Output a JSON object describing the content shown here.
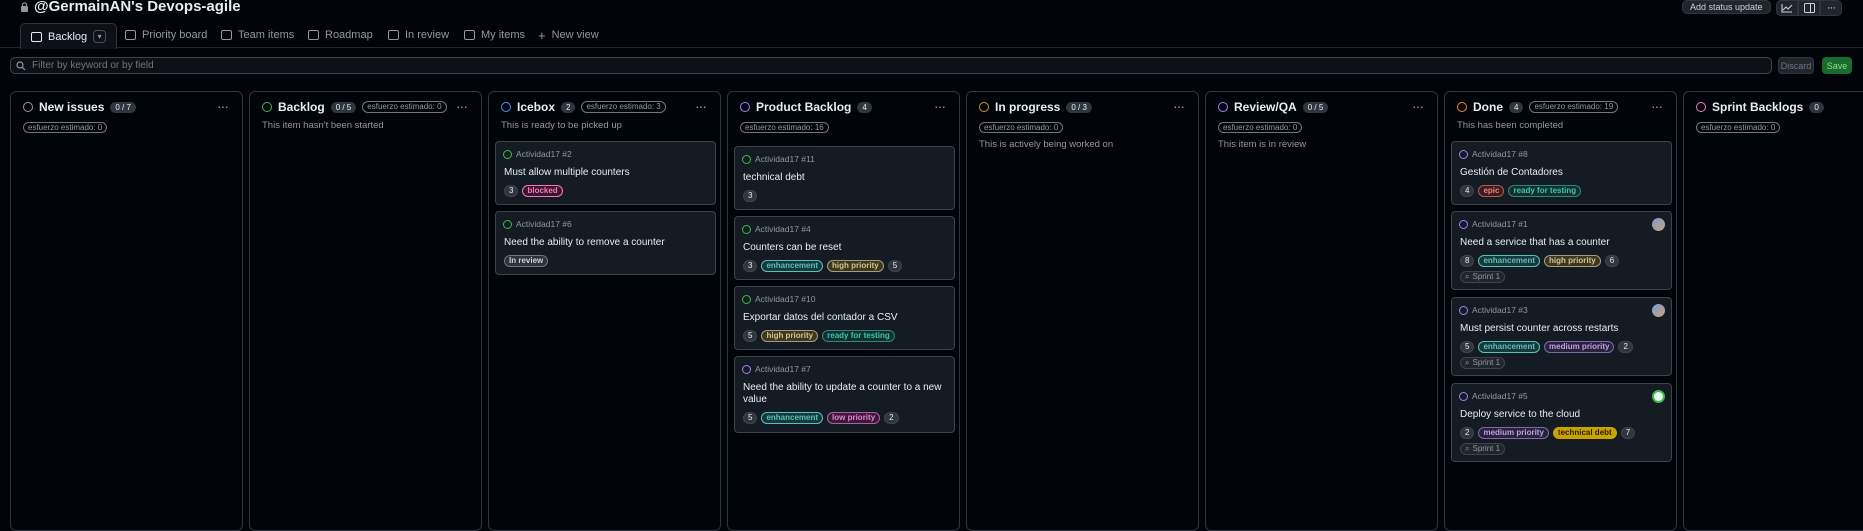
{
  "header": {
    "title": "@GermainAN's Devops-agile",
    "add_status_label": "Add status update"
  },
  "tabs": [
    {
      "label": "Backlog",
      "icon": "board-icon"
    },
    {
      "label": "Priority board",
      "icon": "board-icon"
    },
    {
      "label": "Team items",
      "icon": "table-icon"
    },
    {
      "label": "Roadmap",
      "icon": "roadmap-icon"
    },
    {
      "label": "In review",
      "icon": "table-icon"
    },
    {
      "label": "My items",
      "icon": "table-icon"
    },
    {
      "label": "New view",
      "icon": "plus-icon"
    }
  ],
  "filter": {
    "placeholder": "Filter by keyword or by field",
    "discard_label": "Discard",
    "save_label": "Save"
  },
  "colors": {
    "gray": "#9198a1",
    "green": "#3fb950",
    "blue": "#4493f8",
    "purple": "#ab7df8",
    "orange": "#d29922",
    "done": "#f0883e",
    "pink": "#f778ba",
    "enhancement": "#5ebfbf",
    "high_priority": "#d4c48a",
    "blocked": "#f778ba"
  },
  "columns": [
    {
      "name": "New issues",
      "count": "0 / 7",
      "estimate": "esfuerzo estimado: 0",
      "desc": "",
      "color": "gray"
    },
    {
      "name": "Backlog",
      "count": "0 / 5",
      "estimate": "esfuerzo estimado: 0",
      "desc": "This item hasn't been started",
      "color": "green"
    },
    {
      "name": "Icebox",
      "count": "2",
      "estimate": "esfuerzo estimado: 3",
      "desc": "This is ready to be picked up",
      "color": "blue"
    },
    {
      "name": "Product Backlog",
      "count": "4",
      "estimate": "esfuerzo estimado: 16",
      "desc": "",
      "color": "purple"
    },
    {
      "name": "In progress",
      "count": "0 / 3",
      "estimate": "esfuerzo estimado: 0",
      "desc": "This is actively being worked on",
      "color": "orange"
    },
    {
      "name": "Review/QA",
      "count": "0 / 5",
      "estimate": "esfuerzo estimado: 0",
      "desc": "This item is in review",
      "color": "purple"
    },
    {
      "name": "Done",
      "count": "4",
      "estimate": "esfuerzo estimado: 19",
      "desc": "This has been completed",
      "color": "done"
    },
    {
      "name": "Sprint Backlogs",
      "count": "0",
      "estimate": "esfuerzo estimado: 0",
      "desc": "",
      "color": "pink"
    }
  ],
  "cards": {
    "icebox": [
      {
        "ref": "Actividad17 #2",
        "title": "Must allow multiple counters",
        "num": "3",
        "labels": [
          "blocked"
        ]
      },
      {
        "ref": "Actividad17 #6",
        "title": "Need the ability to remove a counter",
        "labels": [
          "In review"
        ]
      }
    ],
    "product_backlog": [
      {
        "ref": "Actividad17 #11",
        "title": "technical debt",
        "num": "3"
      },
      {
        "ref": "Actividad17 #4",
        "title": "Counters can be reset",
        "num": "3",
        "labels": [
          "enhancement",
          "high priority"
        ],
        "extra": "5"
      },
      {
        "ref": "Actividad17 #10",
        "title": "Exportar datos del contador a CSV",
        "num": "5",
        "labels": [
          "high priority",
          "ready for testing"
        ]
      },
      {
        "ref": "Actividad17 #7",
        "title": "Need the ability to update a counter to a new value",
        "num": "5",
        "labels": [
          "enhancement",
          "low priority"
        ],
        "extra": "2"
      }
    ],
    "done": [
      {
        "ref": "Actividad17 #8",
        "title": "Gestión de Contadores",
        "num": "4",
        "labels": [
          "epic",
          "ready for testing"
        ]
      },
      {
        "ref": "Actividad17 #1",
        "title": "Need a service that has a counter",
        "num": "8",
        "labels": [
          "enhancement",
          "high priority"
        ],
        "extra": "6",
        "sprint": "Sprint 1"
      },
      {
        "ref": "Actividad17 #3",
        "title": "Must persist counter across restarts",
        "num": "5",
        "labels": [
          "enhancement",
          "medium priority"
        ],
        "extra": "2",
        "sprint": "Sprint 1"
      },
      {
        "ref": "Actividad17 #5",
        "title": "Deploy service to the cloud",
        "num": "2",
        "labels": [
          "medium priority",
          "technical debt"
        ],
        "extra": "7",
        "sprint": "Sprint 1"
      }
    ]
  }
}
